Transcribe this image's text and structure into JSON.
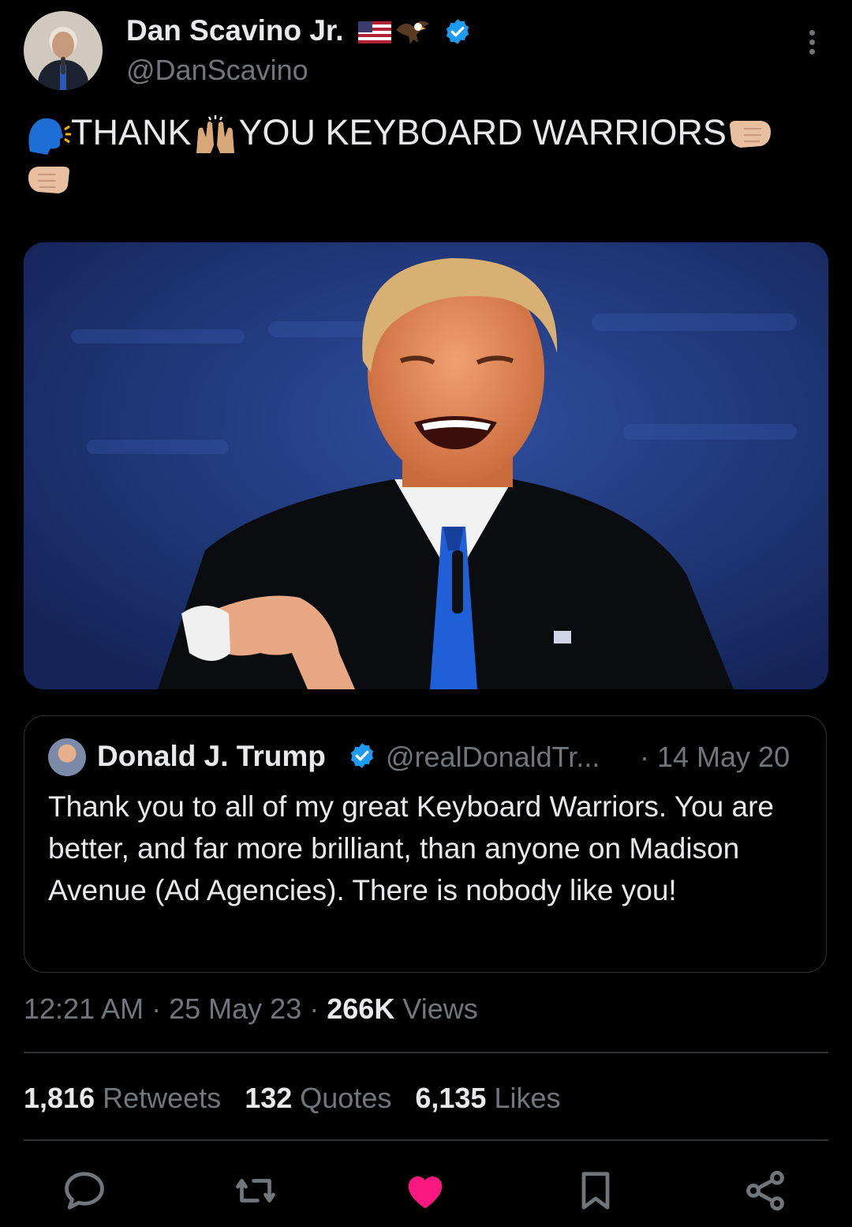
{
  "author": {
    "display_name": "Dan Scavino Jr.",
    "handle": "@DanScavino",
    "verified_color": "#1d9bf0"
  },
  "tweet": {
    "text": "THANK YOU KEYBOARD WARRIORS",
    "text_part1": "THANK",
    "text_part2": "YOU KEYBOARD WARRIORS",
    "emojis": [
      "speaking-head-icon",
      "raising-hands-icon",
      "right-fist-icon",
      "left-fist-icon"
    ]
  },
  "quote": {
    "display_name": "Donald J. Trump",
    "handle": "@realDonaldTr...",
    "date": "· 14 May 20",
    "text": "Thank you to all of my great Keyboard Warriors. You are better, and far more brilliant, than anyone on Madison Avenue (Ad Agencies). There is nobody like you!"
  },
  "meta": {
    "time": "12:21 AM",
    "date": "25 May 23",
    "views_count": "266K",
    "views_label": "Views"
  },
  "stats": {
    "retweets_count": "1,816",
    "retweets_label": "Retweets",
    "quotes_count": "132",
    "quotes_label": "Quotes",
    "likes_count": "6,135",
    "likes_label": "Likes"
  },
  "actions": [
    "reply-icon",
    "retweet-icon",
    "like-icon",
    "bookmark-icon",
    "share-icon"
  ],
  "colors": {
    "background": "#000000",
    "text": "#e7e9ea",
    "muted": "#71767b",
    "like_active": "#f91880",
    "border": "#2f3336"
  }
}
